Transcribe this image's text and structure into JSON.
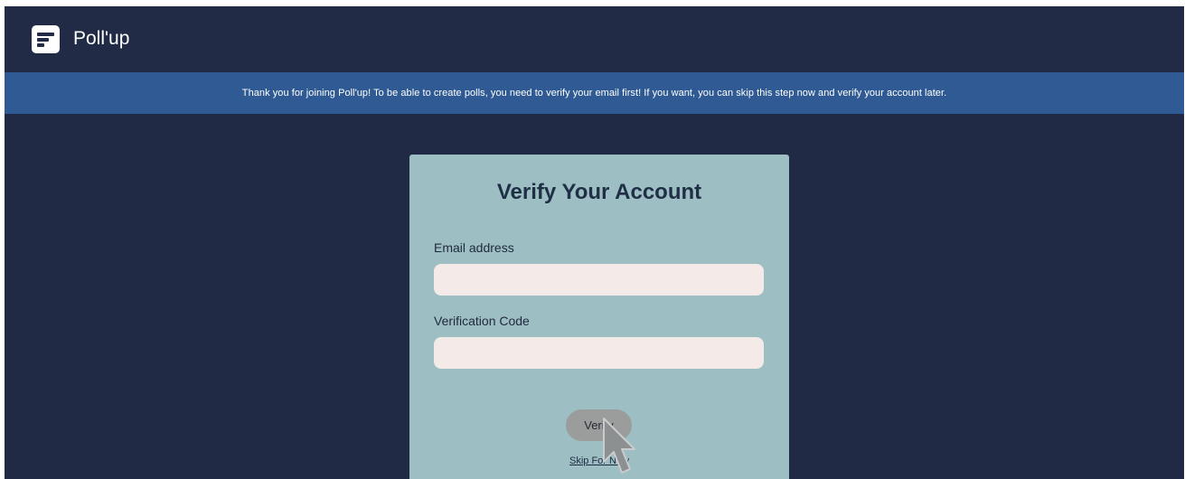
{
  "app": {
    "title": "Poll'up",
    "logo_icon": "poll-document-icon"
  },
  "banner": {
    "message": "Thank you for joining Poll'up! To be able to create polls, you need to verify your email first! If you want, you can skip this step now and verify your account later."
  },
  "verify_form": {
    "title": "Verify Your Account",
    "email_label": "Email address",
    "email_value": "",
    "code_label": "Verification Code",
    "code_value": "",
    "verify_button_label": "Verify",
    "skip_link_label": "Skip For Now"
  },
  "colors": {
    "background": "#202a44",
    "banner": "#2f5a93",
    "card": "#9dbfc4",
    "input_fill": "#f4ebe8",
    "button": "#9a9d9c",
    "heading_text": "#1f2f45"
  },
  "cursor_icon": "mouse-pointer-icon"
}
